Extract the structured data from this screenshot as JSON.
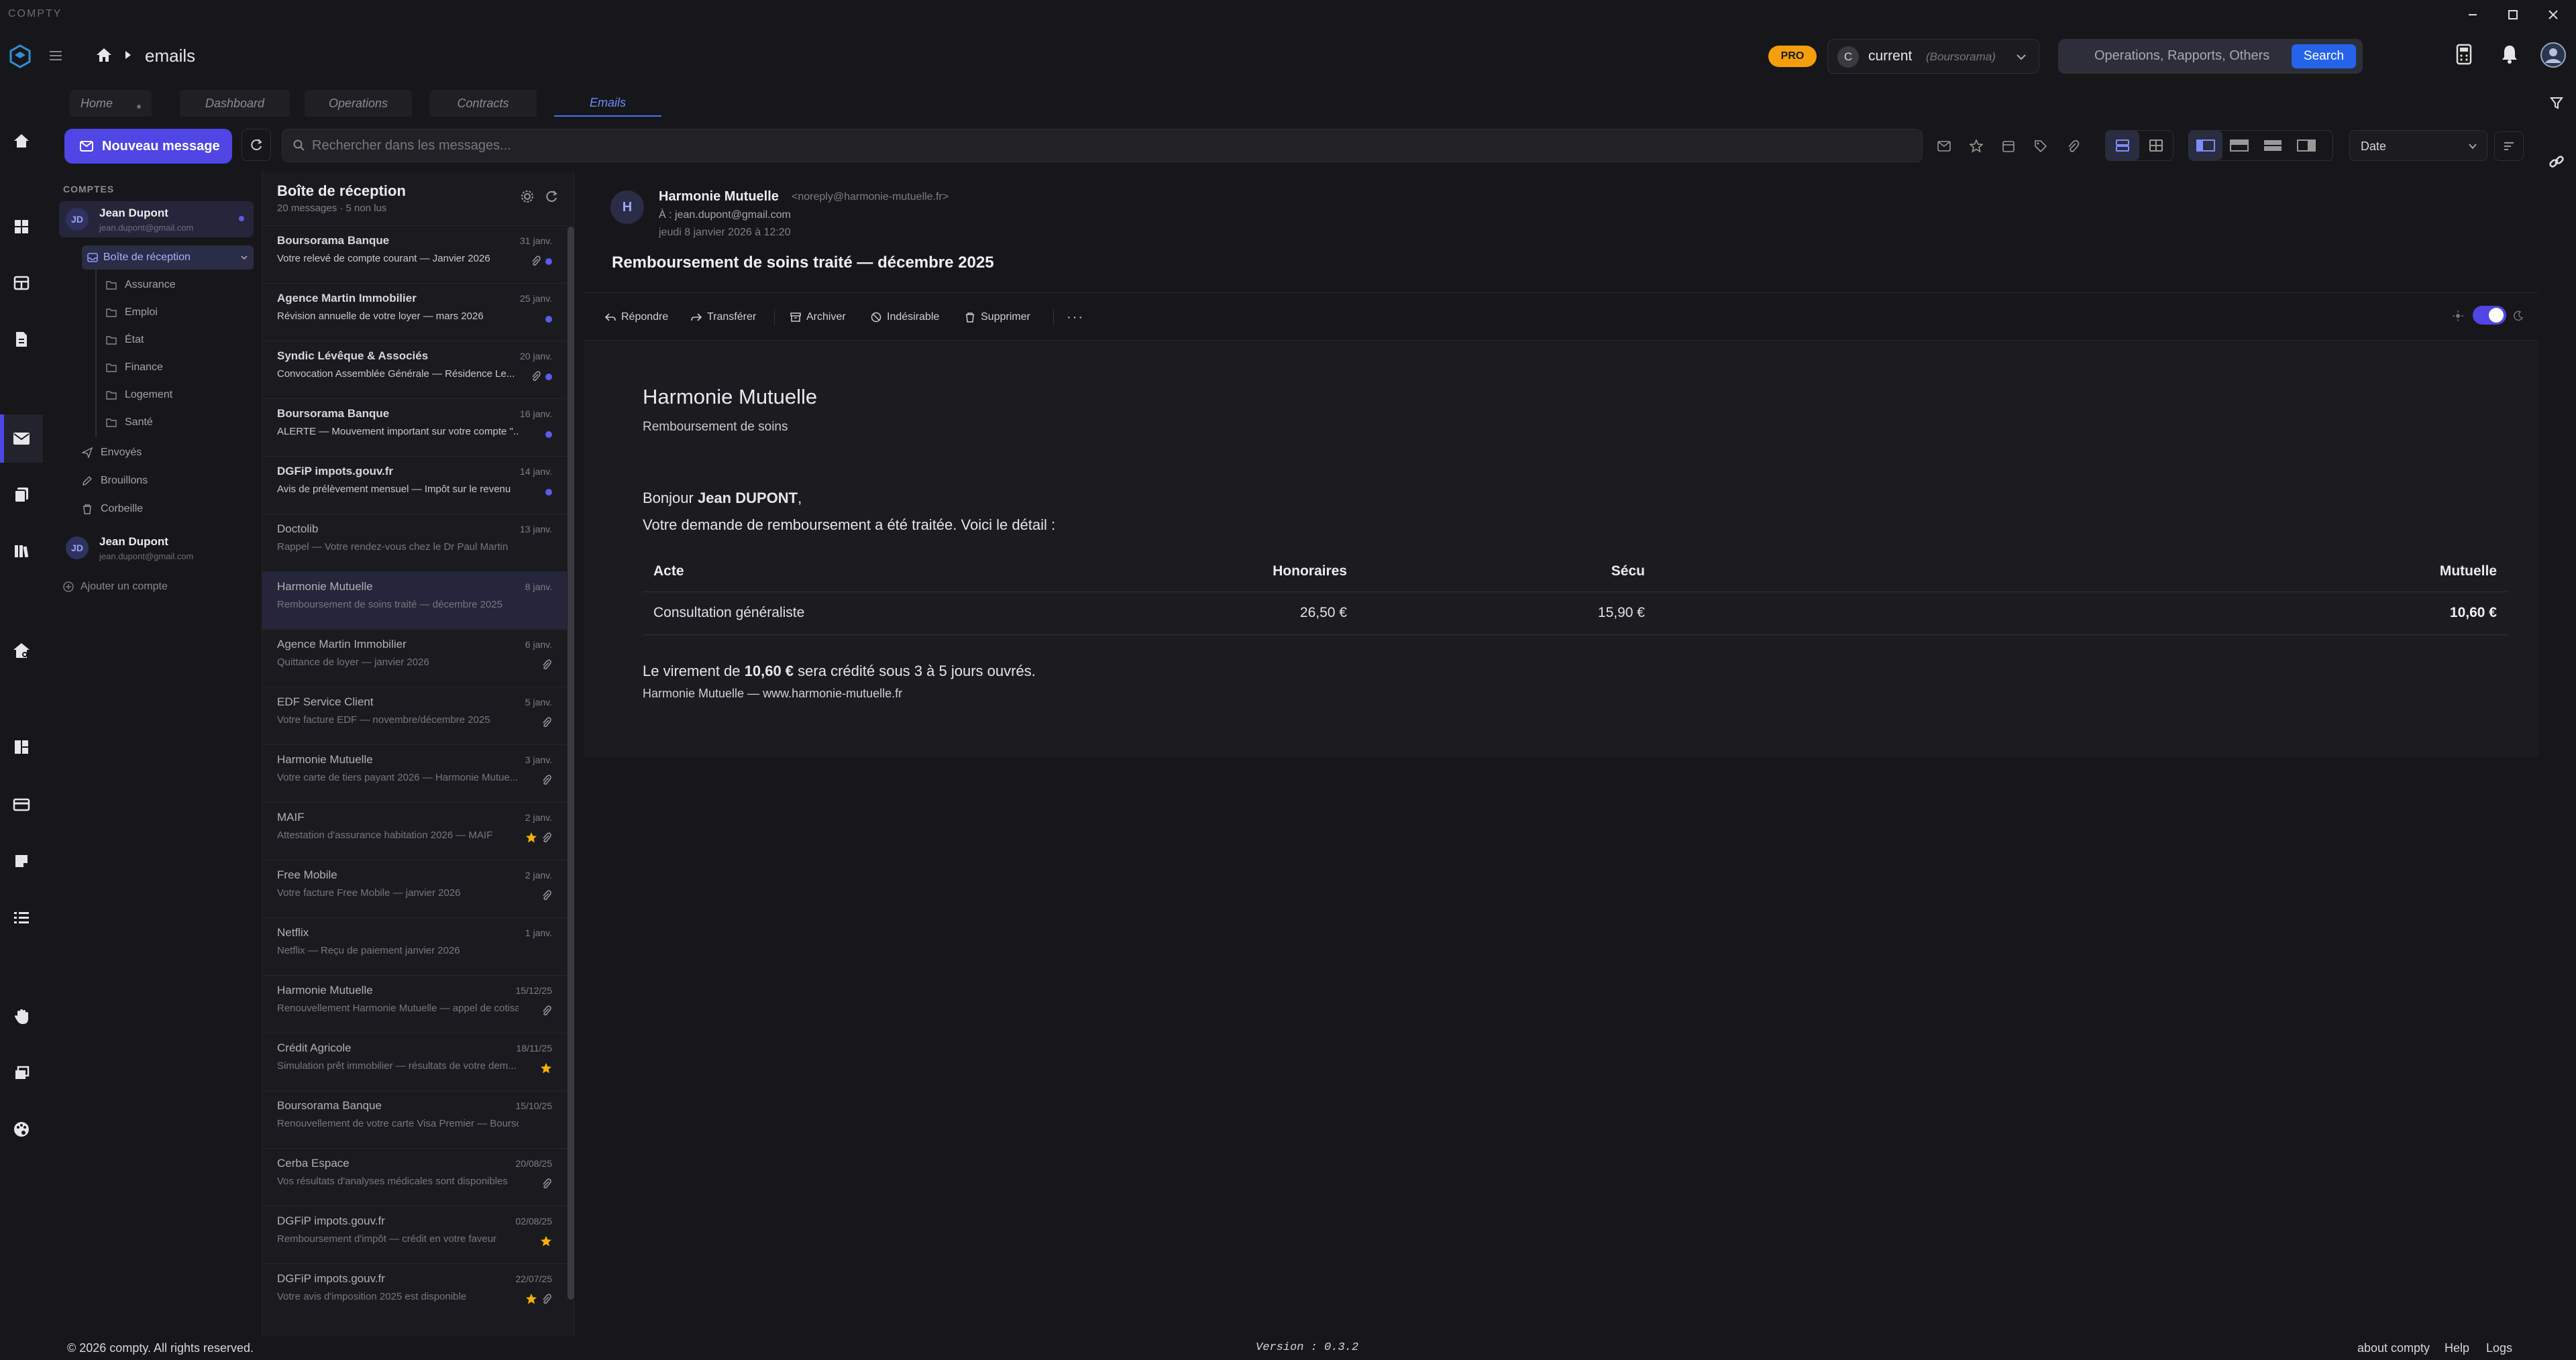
{
  "app": {
    "name": "COMPTY"
  },
  "header": {
    "breadcrumb": "emails",
    "pro_badge": "PRO",
    "account": {
      "initial": "C",
      "name": "current",
      "bank": "(Boursorama)"
    },
    "search": {
      "placeholder": "Operations, Rapports, Others",
      "button": "Search"
    }
  },
  "tabs": [
    "Home",
    "Dashboard",
    "Operations",
    "Contracts",
    "Emails"
  ],
  "toolbar": {
    "new_message": "Nouveau message",
    "search_placeholder": "Rechercher dans les messages...",
    "sort": "Date"
  },
  "accounts": {
    "section_label": "COMPTES",
    "primary": {
      "initials": "JD",
      "name": "Jean Dupont",
      "email": "jean.dupont@gmail.com"
    },
    "inbox_label": "Boîte de réception",
    "subfolders": [
      "Assurance",
      "Emploi",
      "État",
      "Finance",
      "Logement",
      "Santé"
    ],
    "folders": [
      "Envoyés",
      "Brouillons",
      "Corbeille"
    ],
    "secondary": {
      "initials": "JD",
      "name": "Jean Dupont",
      "email": "jean.dupont@gmail.com"
    },
    "add_account": "Ajouter un compte"
  },
  "message_list": {
    "title": "Boîte de réception",
    "subtitle": "20 messages · 5 non lus",
    "messages": [
      {
        "sender": "Boursorama Banque",
        "subject": "Votre relevé de compte courant — Janvier 2026",
        "date": "31 janv."
      },
      {
        "sender": "Agence Martin Immobilier",
        "subject": "Révision annuelle de votre loyer — mars 2026",
        "date": "25 janv."
      },
      {
        "sender": "Syndic Lévêque & Associés",
        "subject": "Convocation Assemblée Générale — Résidence Le...",
        "date": "20 janv."
      },
      {
        "sender": "Boursorama Banque",
        "subject": "ALERTE — Mouvement important sur votre compte \"...",
        "date": "16 janv."
      },
      {
        "sender": "DGFiP impots.gouv.fr",
        "subject": "Avis de prélèvement mensuel — Impôt sur le revenu",
        "date": "14 janv."
      },
      {
        "sender": "Doctolib",
        "subject": "Rappel — Votre rendez-vous chez le Dr Paul Martin",
        "date": "13 janv."
      },
      {
        "sender": "Harmonie Mutuelle",
        "subject": "Remboursement de soins traité — décembre 2025",
        "date": "8 janv."
      },
      {
        "sender": "Agence Martin Immobilier",
        "subject": "Quittance de loyer — janvier 2026",
        "date": "6 janv."
      },
      {
        "sender": "EDF Service Client",
        "subject": "Votre facture EDF — novembre/décembre 2025",
        "date": "5 janv."
      },
      {
        "sender": "Harmonie Mutuelle",
        "subject": "Votre carte de tiers payant 2026 — Harmonie Mutue...",
        "date": "3 janv."
      },
      {
        "sender": "MAIF",
        "subject": "Attestation d'assurance habitation 2026 — MAIF",
        "date": "2 janv."
      },
      {
        "sender": "Free Mobile",
        "subject": "Votre facture Free Mobile — janvier 2026",
        "date": "2 janv."
      },
      {
        "sender": "Netflix",
        "subject": "Netflix — Reçu de paiement janvier 2026",
        "date": "1 janv."
      },
      {
        "sender": "Harmonie Mutuelle",
        "subject": "Renouvellement Harmonie Mutuelle — appel de cotisa...",
        "date": "15/12/25"
      },
      {
        "sender": "Crédit Agricole",
        "subject": "Simulation prêt immobilier — résultats de votre dem...",
        "date": "18/11/25"
      },
      {
        "sender": "Boursorama Banque",
        "subject": "Renouvellement de votre carte Visa Premier — Boursor...",
        "date": "15/10/25"
      },
      {
        "sender": "Cerba Espace",
        "subject": "Vos résultats d'analyses médicales sont disponibles",
        "date": "20/08/25"
      },
      {
        "sender": "DGFiP impots.gouv.fr",
        "subject": "Remboursement d'impôt — crédit en votre faveur",
        "date": "02/08/25"
      },
      {
        "sender": "DGFiP impots.gouv.fr",
        "subject": "Votre avis d'imposition 2025 est disponible",
        "date": "22/07/25"
      }
    ]
  },
  "reader": {
    "avatar": "H",
    "from_name": "Harmonie Mutuelle",
    "from_email": "<noreply@harmonie-mutuelle.fr>",
    "to": "À : jean.dupont@gmail.com",
    "date": "jeudi 8 janvier 2026 à 12:20",
    "subject": "Remboursement de soins traité — décembre 2025",
    "actions": [
      "Répondre",
      "Transférer",
      "Archiver",
      "Indésirable",
      "Supprimer"
    ],
    "body": {
      "brand": "Harmonie Mutuelle",
      "brand_sub": "Remboursement de soins",
      "greeting_prefix": "Bonjour ",
      "greeting_name": "Jean DUPONT",
      "greeting_suffix": ",",
      "intro": "Votre demande de remboursement a été traitée. Voici le détail :",
      "table_headers": [
        "Acte",
        "Honoraires",
        "Sécu",
        "Mutuelle"
      ],
      "table_row": [
        "Consultation généraliste",
        "26,50 €",
        "15,90 €",
        "10,60 €"
      ],
      "virement_prefix": "Le virement de ",
      "virement_amount": "10,60 €",
      "virement_suffix": " sera crédité sous 3 à 5 jours ouvrés.",
      "footer": "Harmonie Mutuelle — www.harmonie-mutuelle.fr"
    }
  },
  "footer": {
    "copyright": "© 2026 compty. All rights reserved.",
    "version": "Version : 0.3.2",
    "links": [
      "about compty",
      "Help",
      "Logs"
    ]
  },
  "colors": {
    "accent": "#4f46e5",
    "pro": "#f59e0b",
    "search_button": "#2563eb",
    "star": "#f5b301",
    "unread_dot": "#5b5bf0"
  }
}
